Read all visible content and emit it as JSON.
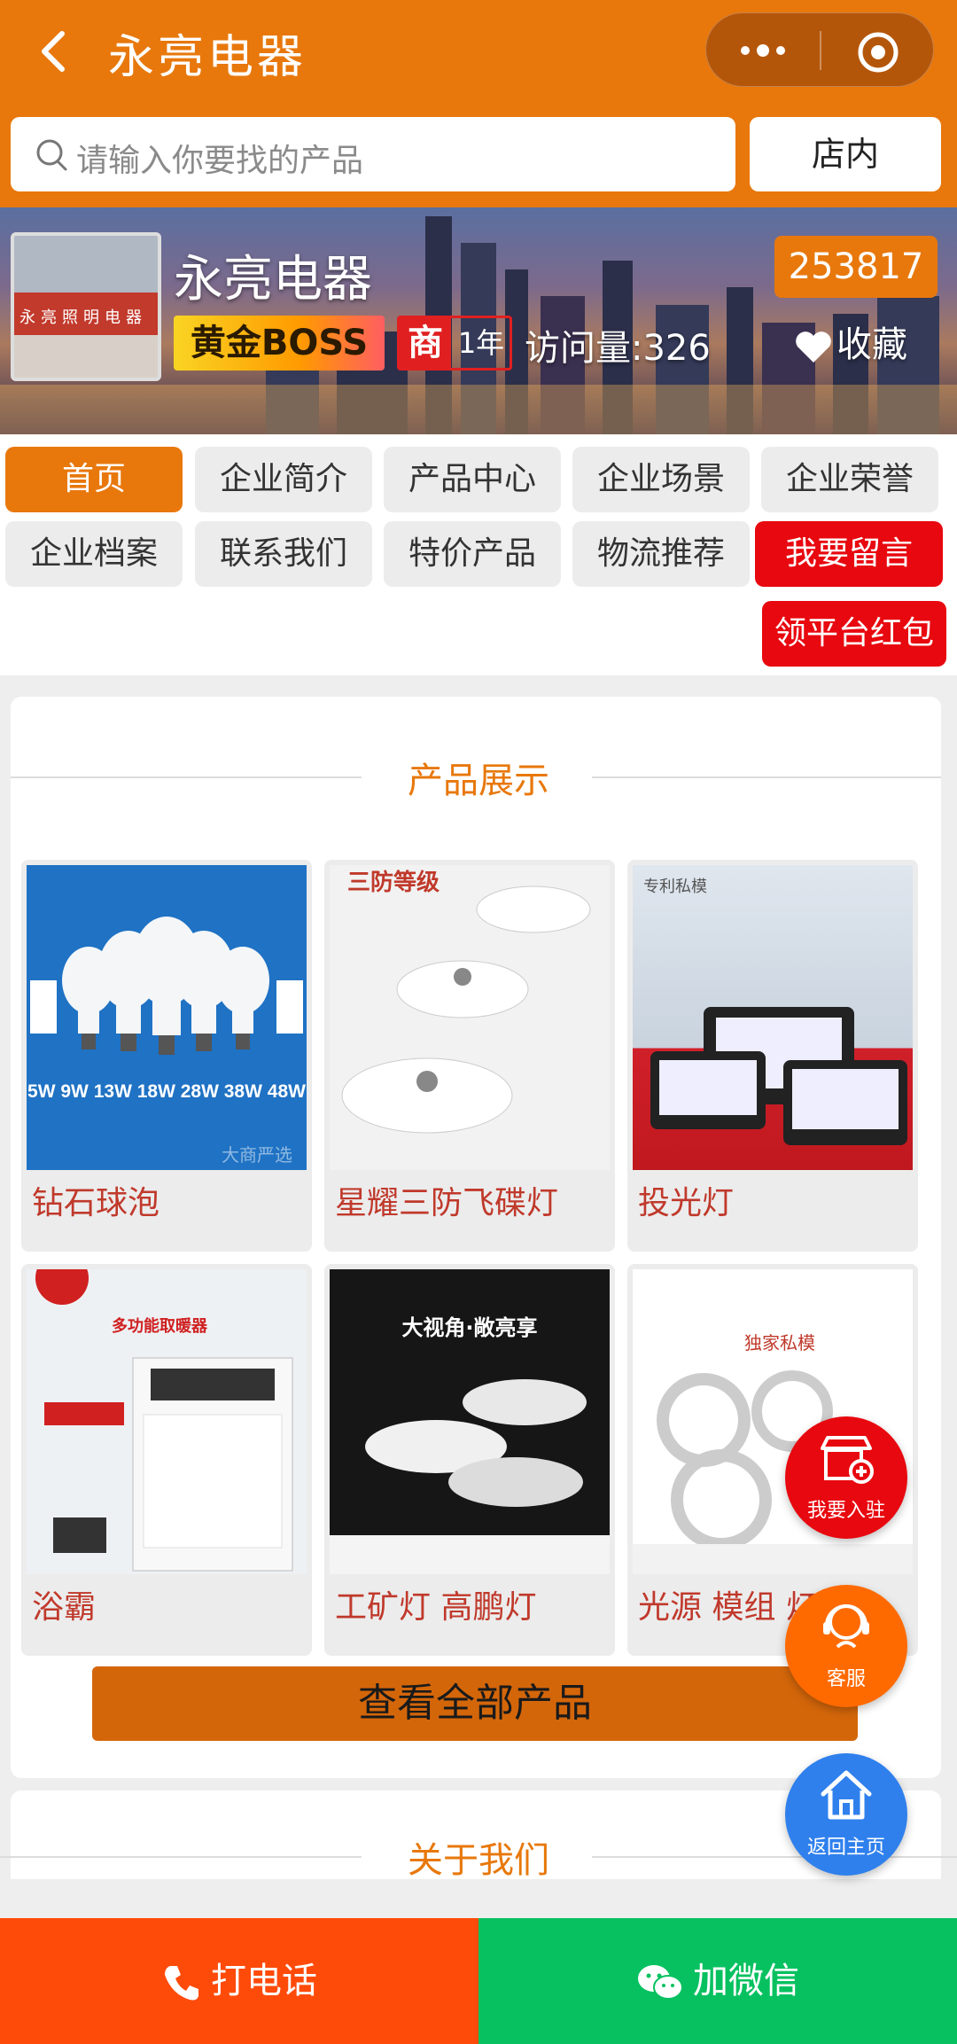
{
  "header": {
    "title": "永亮电器",
    "back_icon": "chevron-left-icon",
    "more_icon": "more-dots-icon",
    "target_icon": "target-icon"
  },
  "search": {
    "placeholder": "请输入你要找的产品",
    "scope_button": "店内"
  },
  "shop": {
    "name": "永亮电器",
    "id_number": "253817",
    "gold_badge": "黄金BOSS",
    "merchant_mark": "商",
    "years": "1年",
    "visits": "访问量:326",
    "favorite": "收藏",
    "photo_sign": "永亮照明电器"
  },
  "nav": {
    "items": [
      "首页",
      "企业简介",
      "产品中心",
      "企业场景",
      "企业荣誉",
      "企业档案",
      "联系我们",
      "特价产品",
      "物流推荐",
      "我要留言"
    ],
    "red_packet": "领平台红包"
  },
  "products": {
    "section_title": "产品展示",
    "items": [
      {
        "name": "钻石球泡",
        "image_text": "5W 9W 13W 18W 28W 38W 48W",
        "watermark": "大商严选"
      },
      {
        "name": "星耀三防飞碟灯",
        "image_text": "三防等级"
      },
      {
        "name": "投光灯",
        "image_text": "专利私模"
      },
      {
        "name": "浴霸",
        "image_text": "多功能取暖器"
      },
      {
        "name": "工矿灯 高鹏灯",
        "image_text": "大视角·敞亮享"
      },
      {
        "name": "光源 模组 灯板",
        "image_text": "独家私模"
      }
    ],
    "view_all": "查看全部产品"
  },
  "about": {
    "section_title": "关于我们"
  },
  "floating": {
    "join": "我要入驻",
    "service": "客服",
    "home": "返回主页"
  },
  "bottom": {
    "call": "打电话",
    "wechat": "加微信"
  },
  "colors": {
    "brand_orange": "#e8780c",
    "red": "#e8080f",
    "call_orange": "#ff4b0a",
    "wechat_green": "#07c160",
    "home_blue": "#2f80ed"
  }
}
